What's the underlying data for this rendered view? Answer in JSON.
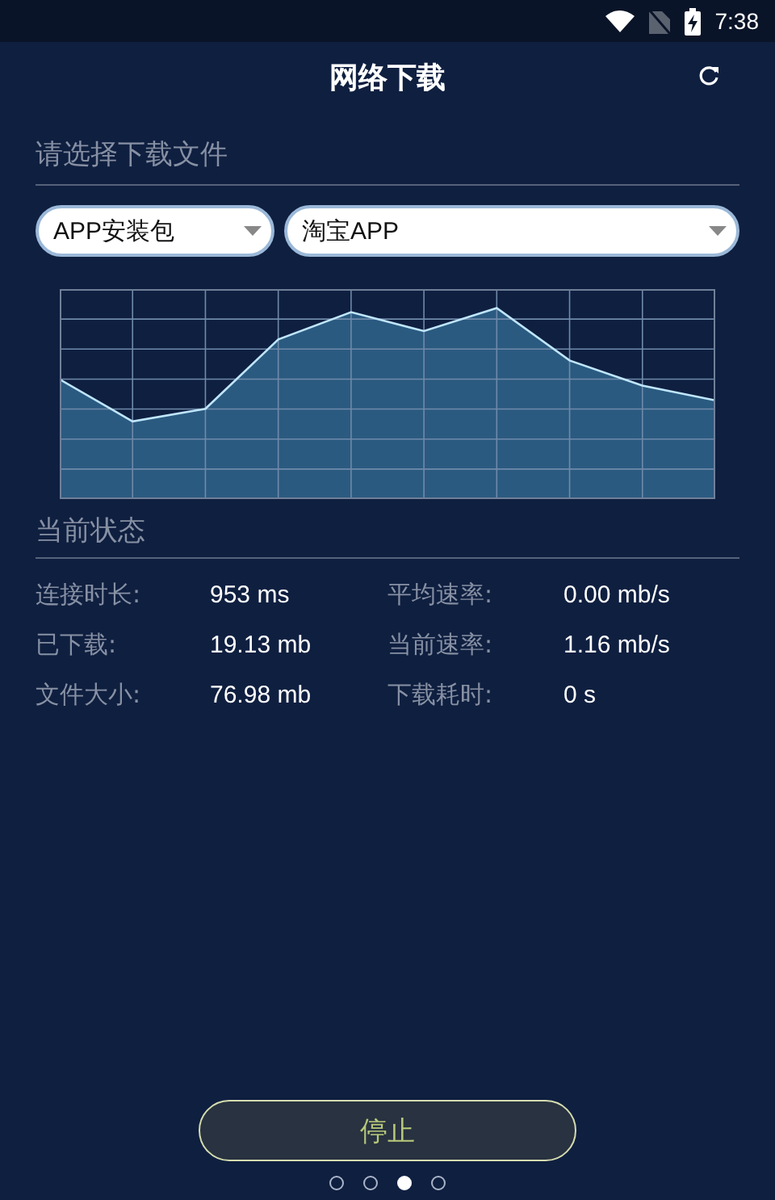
{
  "status_bar": {
    "time": "7:38"
  },
  "header": {
    "title": "网络下载"
  },
  "file_section": {
    "title": "请选择下载文件"
  },
  "dropdowns": [
    {
      "value": "APP安装包"
    },
    {
      "value": "淘宝APP"
    }
  ],
  "status_section": {
    "title": "当前状态"
  },
  "stats": [
    {
      "label": "连接时长:",
      "value": "953 ms"
    },
    {
      "label": "平均速率:",
      "value": "0.00 mb/s"
    },
    {
      "label": "已下载:",
      "value": "19.13 mb"
    },
    {
      "label": "当前速率:",
      "value": "1.16 mb/s"
    },
    {
      "label": "文件大小:",
      "value": "76.98 mb"
    },
    {
      "label": "下载耗时:",
      "value": "0 s"
    }
  ],
  "stop_button": {
    "label": "停止"
  },
  "page_dots": [
    {
      "selected": false
    },
    {
      "selected": false
    },
    {
      "selected": true
    },
    {
      "selected": false
    }
  ]
}
